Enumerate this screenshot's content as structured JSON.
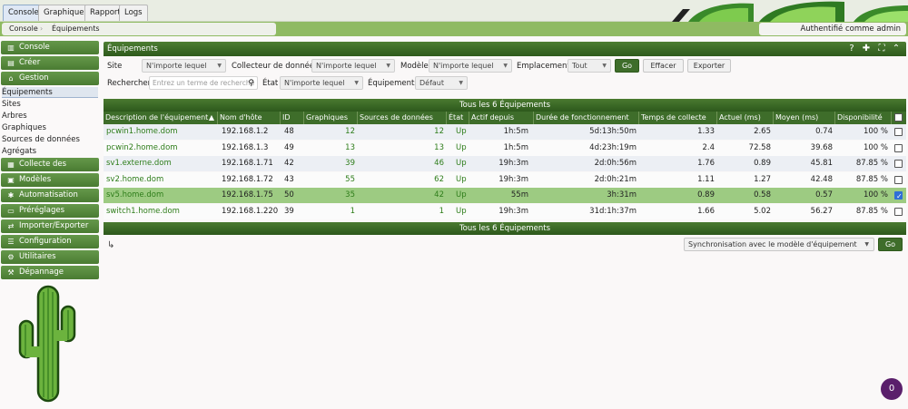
{
  "top_tabs": [
    {
      "label": "Console",
      "active": true
    },
    {
      "label": "Graphiques",
      "active": false
    },
    {
      "label": "Rapport",
      "active": false
    },
    {
      "label": "Logs",
      "active": false
    }
  ],
  "breadcrumb": [
    "Console",
    "Équipements"
  ],
  "auth_text": "Authentifié comme admin",
  "sidebar": {
    "items": [
      {
        "label": "Console",
        "type": "head",
        "icon": "map-icon"
      },
      {
        "label": "Créer",
        "type": "head",
        "icon": "create-icon"
      },
      {
        "label": "Gestion",
        "type": "head",
        "icon": "home-icon"
      },
      {
        "label": "Équipements",
        "type": "sub",
        "selected": true
      },
      {
        "label": "Sites",
        "type": "sub"
      },
      {
        "label": "Arbres",
        "type": "sub"
      },
      {
        "label": "Graphiques",
        "type": "sub"
      },
      {
        "label": "Sources de données",
        "type": "sub"
      },
      {
        "label": "Agrégats",
        "type": "sub"
      },
      {
        "label": "Collecte des données",
        "type": "head",
        "icon": "database-icon"
      },
      {
        "label": "Modèles",
        "type": "head",
        "icon": "template-icon"
      },
      {
        "label": "Automatisation",
        "type": "head",
        "icon": "automation-icon"
      },
      {
        "label": "Préréglages",
        "type": "head",
        "icon": "presets-icon"
      },
      {
        "label": "Importer/Exporter",
        "type": "head",
        "icon": "import-export-icon"
      },
      {
        "label": "Configuration",
        "type": "head",
        "icon": "configuration-icon"
      },
      {
        "label": "Utilitaires",
        "type": "head",
        "icon": "utilities-icon"
      },
      {
        "label": "Dépannage",
        "type": "head",
        "icon": "troubleshoot-icon"
      }
    ]
  },
  "panel": {
    "title": "Équipements",
    "header_icons": [
      "help-icon",
      "add-icon",
      "expand-icon",
      "collapse-icon"
    ],
    "filters": {
      "site_label": "Site",
      "site_value": "N'importe lequel",
      "collector_label": "Collecteur de données",
      "collector_value": "N'importe lequel",
      "model_label": "Modèle",
      "model_value": "N'importe lequel",
      "location_label": "Emplacement",
      "location_value": "Tout",
      "go_label": "Go",
      "clear_label": "Effacer",
      "export_label": "Exporter",
      "search_label": "Rechercher",
      "search_placeholder": "Entrez un terme de recherche",
      "state_label": "État",
      "state_value": "N'importe lequel",
      "devices_label": "Équipements",
      "devices_value": "Défaut"
    },
    "nav_text": "Tous les 6 Équipements",
    "columns": [
      "Description de l'équipement",
      "Nom d'hôte",
      "ID",
      "Graphiques",
      "Sources de données",
      "État",
      "Actif depuis",
      "Durée de fonctionnement",
      "Temps de collecte",
      "Actuel (ms)",
      "Moyen (ms)",
      "Disponibilité"
    ],
    "sort_indicator": "▲",
    "rows": [
      {
        "description": "pcwin1.home.dom",
        "hostname": "192.168.1.2",
        "id": "48",
        "graphs": "12",
        "datasources": "12",
        "state": "Up",
        "in_state": "1h:5m",
        "uptime": "5d:13h:50m",
        "poll_time": "1.33",
        "current": "2.65",
        "average": "0.74",
        "availability": "100 %",
        "checked": false
      },
      {
        "description": "pcwin2.home.dom",
        "hostname": "192.168.1.3",
        "id": "49",
        "graphs": "13",
        "datasources": "13",
        "state": "Up",
        "in_state": "1h:5m",
        "uptime": "4d:23h:19m",
        "poll_time": "2.4",
        "current": "72.58",
        "average": "39.68",
        "availability": "100 %",
        "checked": false
      },
      {
        "description": "sv1.externe.dom",
        "hostname": "192.168.1.71",
        "id": "42",
        "graphs": "39",
        "datasources": "46",
        "state": "Up",
        "in_state": "19h:3m",
        "uptime": "2d:0h:56m",
        "poll_time": "1.76",
        "current": "0.89",
        "average": "45.81",
        "availability": "87.85 %",
        "checked": false
      },
      {
        "description": "sv2.home.dom",
        "hostname": "192.168.1.72",
        "id": "43",
        "graphs": "55",
        "datasources": "62",
        "state": "Up",
        "in_state": "19h:3m",
        "uptime": "2d:0h:21m",
        "poll_time": "1.11",
        "current": "1.27",
        "average": "42.48",
        "availability": "87.85 %",
        "checked": false
      },
      {
        "description": "sv5.home.dom",
        "hostname": "192.168.1.75",
        "id": "50",
        "graphs": "35",
        "datasources": "42",
        "state": "Up",
        "in_state": "55m",
        "uptime": "3h:31m",
        "poll_time": "0.89",
        "current": "0.58",
        "average": "0.57",
        "availability": "100 %",
        "checked": true
      },
      {
        "description": "switch1.home.dom",
        "hostname": "192.168.1.220",
        "id": "39",
        "graphs": "1",
        "datasources": "1",
        "state": "Up",
        "in_state": "19h:3m",
        "uptime": "31d:1h:37m",
        "poll_time": "1.66",
        "current": "5.02",
        "average": "56.27",
        "availability": "87.85 %",
        "checked": false
      }
    ],
    "action_select": "Synchronisation avec le modèle d'équipement",
    "action_go": "Go"
  },
  "notification_count": "0",
  "colors": {
    "accent": "#3e6d2a",
    "link_green": "#2e7d1a",
    "highlight_row": "#9dcb82"
  }
}
